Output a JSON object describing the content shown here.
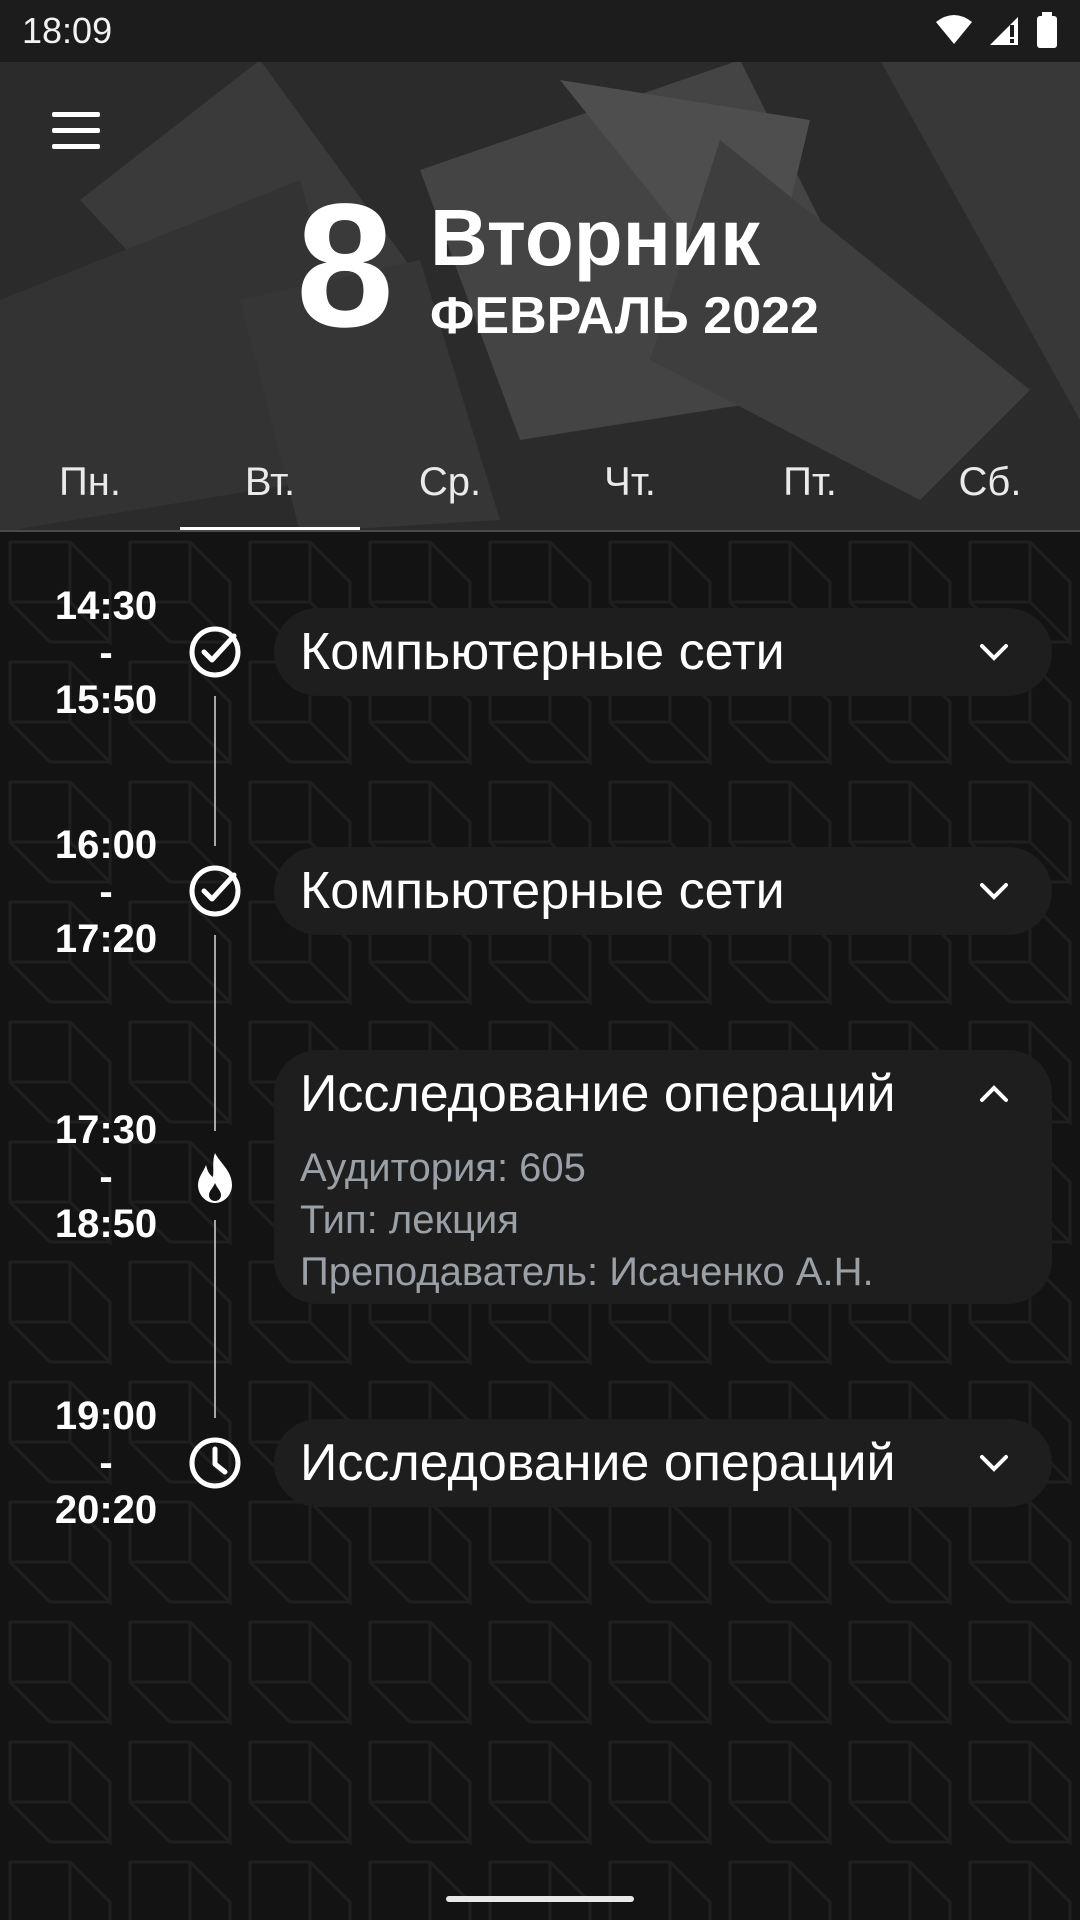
{
  "status_bar": {
    "time": "18:09"
  },
  "header": {
    "day_number": "8",
    "weekday": "Вторник",
    "month_year": "ФЕВРАЛЬ 2022"
  },
  "tabs": [
    {
      "label": "Пн.",
      "active": false
    },
    {
      "label": "Вт.",
      "active": true
    },
    {
      "label": "Ср.",
      "active": false
    },
    {
      "label": "Чт.",
      "active": false
    },
    {
      "label": "Пт.",
      "active": false
    },
    {
      "label": "Сб.",
      "active": false
    }
  ],
  "lessons": [
    {
      "start": "14:30",
      "sep": "-",
      "end": "15:50",
      "status_icon": "check-circle-icon",
      "title": "Компьютерные сети",
      "expanded": false
    },
    {
      "start": "16:00",
      "sep": "-",
      "end": "17:20",
      "status_icon": "check-circle-icon",
      "title": "Компьютерные сети",
      "expanded": false
    },
    {
      "start": "17:30",
      "sep": "-",
      "end": "18:50",
      "status_icon": "flame-icon",
      "title": "Исследование операций",
      "expanded": true,
      "details": {
        "room": "Аудитория: 605",
        "type": "Тип: лекция",
        "teacher": "Преподаватель: Исаченко А.Н."
      }
    },
    {
      "start": "19:00",
      "sep": "-",
      "end": "20:20",
      "status_icon": "clock-icon",
      "title": "Исследование операций",
      "expanded": false
    }
  ],
  "colors": {
    "background": "#131313",
    "card": "#1e1e1e",
    "detail_text": "#9aa0a6",
    "header": "#2b2b2b"
  }
}
